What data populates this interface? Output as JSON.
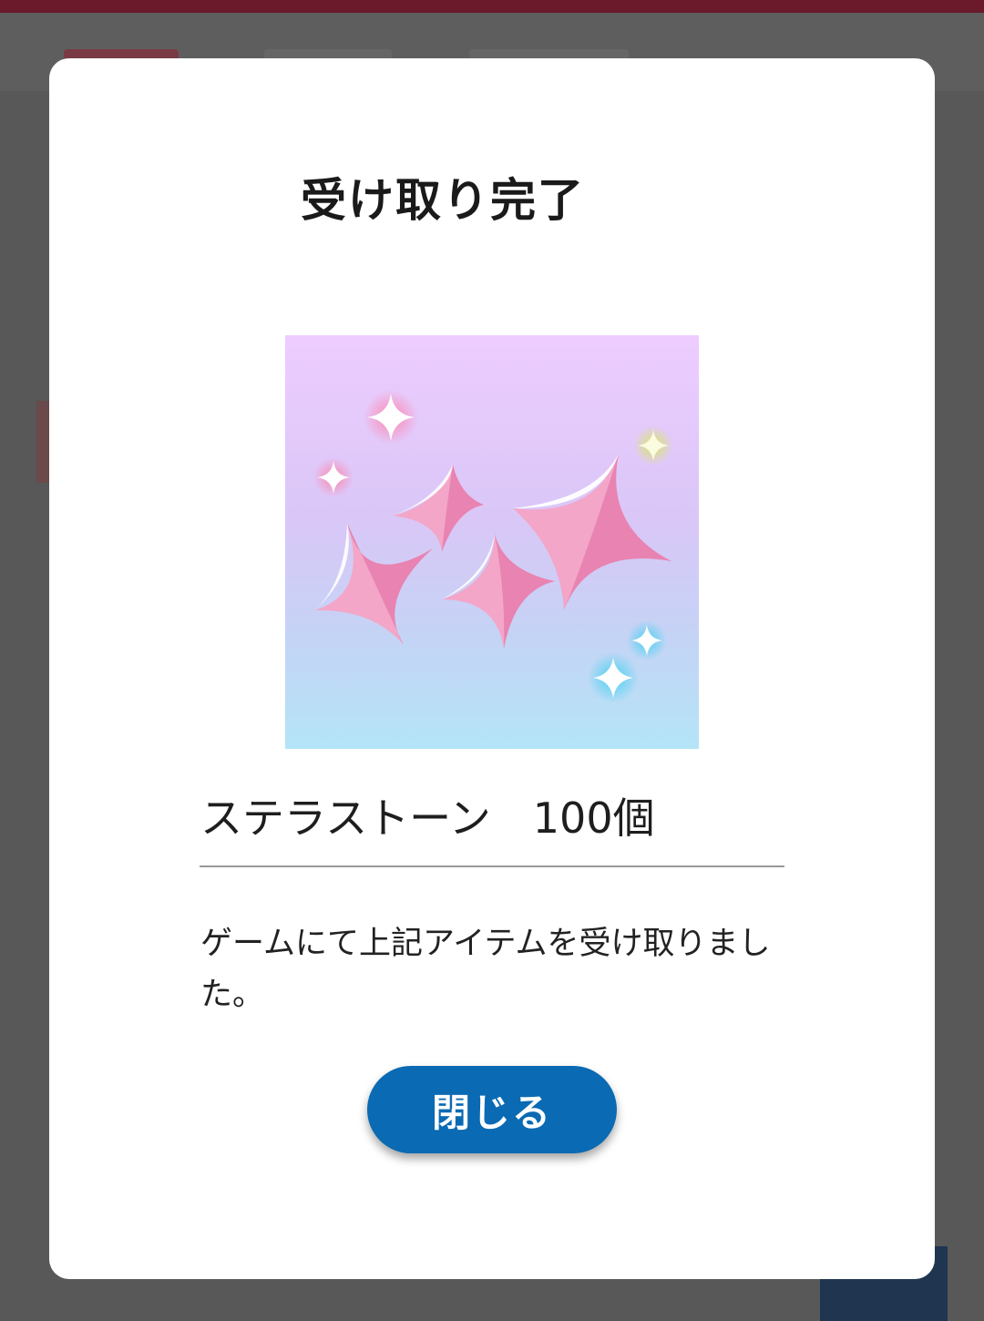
{
  "modal": {
    "title": "受け取り完了",
    "item_name": "ステラストーン　100個",
    "message": "ゲームにて上記アイテムを受け取りました。",
    "close_label": "閉じる",
    "item_image_icon": "sparkles-icon"
  },
  "colors": {
    "backdrop": "#585858",
    "modal_background": "#ffffff",
    "button": "#0a6ab3",
    "button_text": "#ffffff",
    "sparkle_pink": "#f29cc4",
    "image_gradient_top": "#eeccff",
    "image_gradient_bottom": "#b4e4f7"
  }
}
